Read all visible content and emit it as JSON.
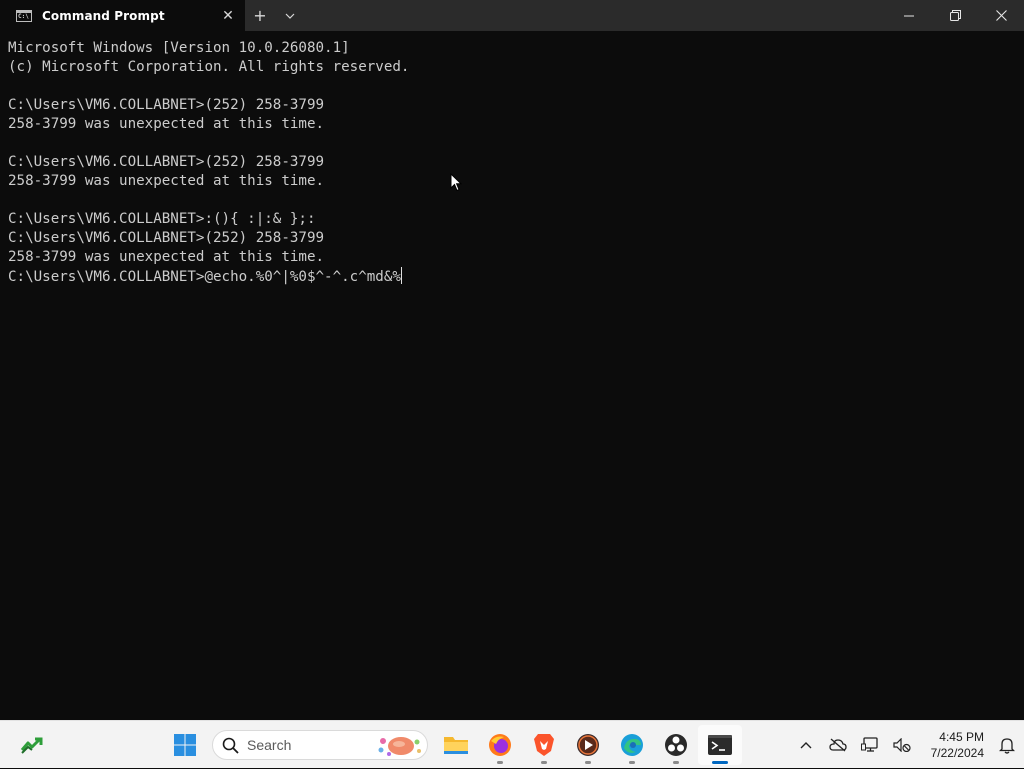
{
  "window": {
    "tab_title": "Command Prompt",
    "close_tab_glyph": "✕",
    "new_tab_glyph": "+",
    "dropdown_glyph": "⌄",
    "minimize_glyph": "—",
    "restore_glyph": "❐",
    "close_glyph": "✕"
  },
  "console": {
    "lines": [
      "Microsoft Windows [Version 10.0.26080.1]",
      "(c) Microsoft Corporation. All rights reserved.",
      "",
      "C:\\Users\\VM6.COLLABNET>(252) 258-3799",
      "258-3799 was unexpected at this time.",
      "",
      "C:\\Users\\VM6.COLLABNET>(252) 258-3799",
      "258-3799 was unexpected at this time.",
      "",
      "C:\\Users\\VM6.COLLABNET>:(){ :|:& };:",
      "C:\\Users\\VM6.COLLABNET>(252) 258-3799",
      "258-3799 was unexpected at this time.",
      "C:\\Users\\VM6.COLLABNET>@echo.%0^|%0$^-^.c^md&%"
    ]
  },
  "taskbar": {
    "search_placeholder": "Search",
    "apps": [
      "file-explorer",
      "firefox",
      "brave",
      "media-player",
      "edge",
      "obs-studio",
      "terminal"
    ],
    "tray": {
      "chevron_glyph": "^",
      "time": "4:45 PM",
      "date": "7/22/2024"
    }
  }
}
